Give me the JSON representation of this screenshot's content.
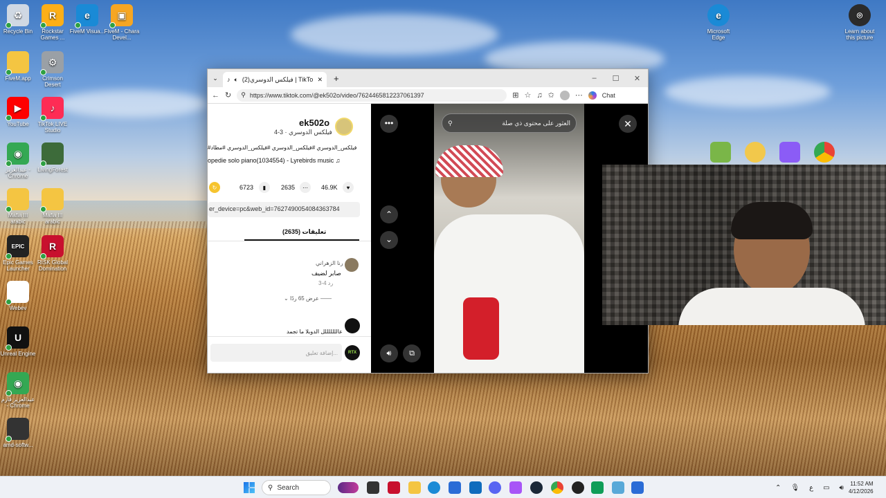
{
  "desktop": {
    "icons_left": [
      {
        "label": "Recycle Bin",
        "color": "#cfd8e3",
        "glyph": "♻"
      },
      {
        "label": "Rockstar Games ...",
        "color": "#fcaf17",
        "glyph": "R"
      },
      {
        "label": "FiveM Visua...",
        "color": "#1a8ad6",
        "glyph": "e"
      },
      {
        "label": "FiveM - Chara Devel...",
        "color": "#f6a623",
        "glyph": "▣"
      },
      {
        "label": "FiveM.app",
        "color": "#f4c542",
        "glyph": ""
      },
      {
        "label": "Crimson Desert",
        "color": "#9aa0a6",
        "glyph": "⚙"
      },
      {
        "label": "YouTube",
        "color": "#ff0000",
        "glyph": "▶"
      },
      {
        "label": "TikTok LIVE Studio",
        "color": "#fe2c55",
        "glyph": "♪"
      },
      {
        "label": "عبدالعزيز - Chrome",
        "color": "#34a853",
        "glyph": "◉"
      },
      {
        "label": "LivingForest",
        "color": "#3d6b3a",
        "glyph": ""
      },
      {
        "label": "Mafia III arabic",
        "color": "#f4c542",
        "glyph": ""
      },
      {
        "label": "Mafia III arabic",
        "color": "#f4c542",
        "glyph": ""
      },
      {
        "label": "Epic Games Launcher",
        "color": "#222222",
        "glyph": "EPIC"
      },
      {
        "label": "RISK Global Domination",
        "color": "#c8102e",
        "glyph": "R"
      },
      {
        "label": "Webev",
        "color": "#ffffff",
        "glyph": ""
      },
      {
        "label": "Unreal Engine",
        "color": "#111111",
        "glyph": "U"
      },
      {
        "label": "عبدالعزيز فارم - Chrome",
        "color": "#34a853",
        "glyph": "◉"
      },
      {
        "label": "amd-softw...",
        "color": "#333333",
        "glyph": ""
      }
    ],
    "icons_right": [
      {
        "label": "Microsoft Edge",
        "color": "#1a8ad6",
        "glyph": "e"
      },
      {
        "label": "Learn about this picture",
        "color": "#2b2b2b",
        "glyph": "⌾"
      }
    ]
  },
  "browser": {
    "tab_title": "(2)فيلكس الدوسري | TikTok (2o",
    "url": "https://www.tiktok.com/@ek502o/video/7624465812237061397",
    "chat_label": "Chat"
  },
  "tiktok": {
    "username": "ek502o",
    "subtitle": "فيلكس الدوسري ·  3-4",
    "hashtags": "#فيلكس_الدوسري #فيلكس_الدوسري #فيلكس_الدوسري #مطاد",
    "music": "opedie solo piano(1034554) - Lyrebirds music",
    "stats": {
      "likes": "46.9K",
      "comments": "2635",
      "saves": "6723"
    },
    "share_link": "er_device=pc&web_id=7627490054084363784",
    "comments_tab": "تعليقات (2635)",
    "comment1": {
      "name": "رنا الزهراني",
      "text": "صابر لضيف",
      "meta": "3-4  رد",
      "replies": "عرض 65 ردًا"
    },
    "comment2": {
      "text": "عالللللللل الدوبلا ما تجمد"
    },
    "comment_placeholder": "إضافة تعليق...",
    "search_placeholder": "العثور على محتوى ذي صلة"
  },
  "taskbar": {
    "search_label": "Search",
    "time": "11:52 AM",
    "date": "4/12/2026",
    "lang": "ع"
  }
}
